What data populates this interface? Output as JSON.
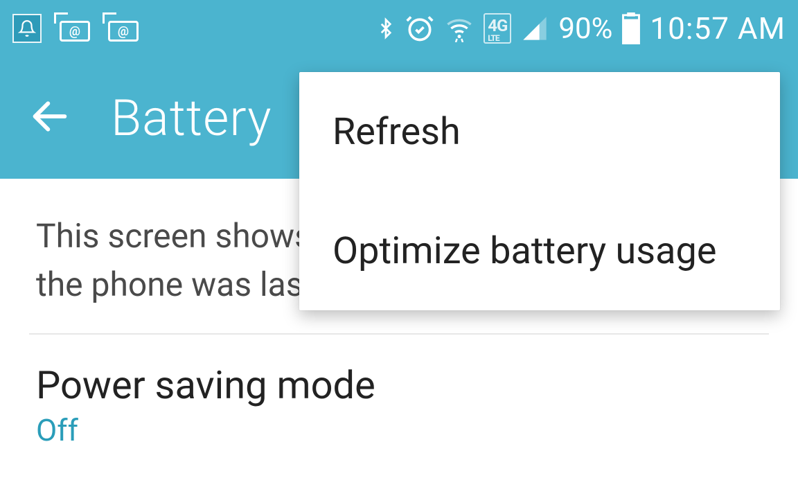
{
  "colors": {
    "teal": "#4bb4cf",
    "text_dark": "#222222",
    "link_teal": "#2a9db9",
    "white": "#ffffff"
  },
  "status_bar": {
    "battery_percent": "90%",
    "time": "10:57 AM",
    "network_label": "4G LTE"
  },
  "app_bar": {
    "title": "Battery"
  },
  "content": {
    "description": "This screen shows the battery usage data since the phone was last fully charged.",
    "power_saving": {
      "title": "Power saving mode",
      "value": "Off"
    }
  },
  "menu": {
    "items": [
      {
        "label": "Refresh"
      },
      {
        "label": "Optimize battery usage"
      }
    ]
  }
}
